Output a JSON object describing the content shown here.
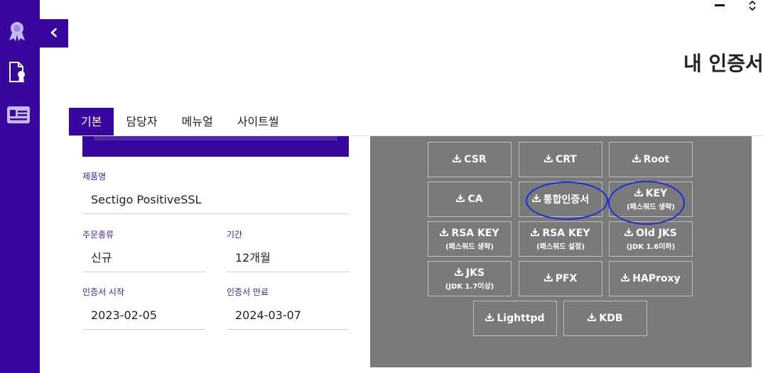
{
  "window": {
    "minimize_icon": "minus-icon",
    "sort_icon": "up-down-chevron-icon"
  },
  "sidebar": {
    "items": [
      {
        "icon": "award-ribbon-icon"
      },
      {
        "icon": "certificate-document-icon"
      },
      {
        "icon": "id-card-icon"
      }
    ],
    "collapse_icon": "chevron-left-icon"
  },
  "page": {
    "title": "내 인증서"
  },
  "tabs": [
    {
      "label": "기본",
      "active": true
    },
    {
      "label": "담당자",
      "active": false
    },
    {
      "label": "메뉴얼",
      "active": false
    },
    {
      "label": "사이트씰",
      "active": false
    }
  ],
  "details": {
    "product_label": "제품명",
    "product_value": "Sectigo PositiveSSL",
    "order_type_label": "주문종류",
    "order_type_value": "신규",
    "period_label": "기간",
    "period_value": "12개월",
    "start_label": "인증서 시작",
    "start_value": "2023-02-05",
    "end_label": "인증서 만료",
    "end_value": "2024-03-07"
  },
  "downloads": {
    "icon": "download-icon",
    "buttons": [
      {
        "label": "CSR",
        "sub": ""
      },
      {
        "label": "CRT",
        "sub": ""
      },
      {
        "label": "Root",
        "sub": ""
      },
      {
        "label": "CA",
        "sub": ""
      },
      {
        "label": "통합인증서",
        "sub": ""
      },
      {
        "label": "KEY",
        "sub": "(패스워드 생략)"
      },
      {
        "label": "RSA KEY",
        "sub": "(패스워드 생략)"
      },
      {
        "label": "RSA KEY",
        "sub": "(패스워드 설정)"
      },
      {
        "label": "Old JKS",
        "sub": "(JDK 1.6이하)"
      },
      {
        "label": "JKS",
        "sub": "(JDK 1.7이상)"
      },
      {
        "label": "PFX",
        "sub": ""
      },
      {
        "label": "HAProxy",
        "sub": ""
      },
      {
        "label": "Lighttpd",
        "sub": ""
      },
      {
        "label": "KDB",
        "sub": ""
      }
    ]
  },
  "annotation_color": "#1a2fd8",
  "accent_color": "#38079d"
}
